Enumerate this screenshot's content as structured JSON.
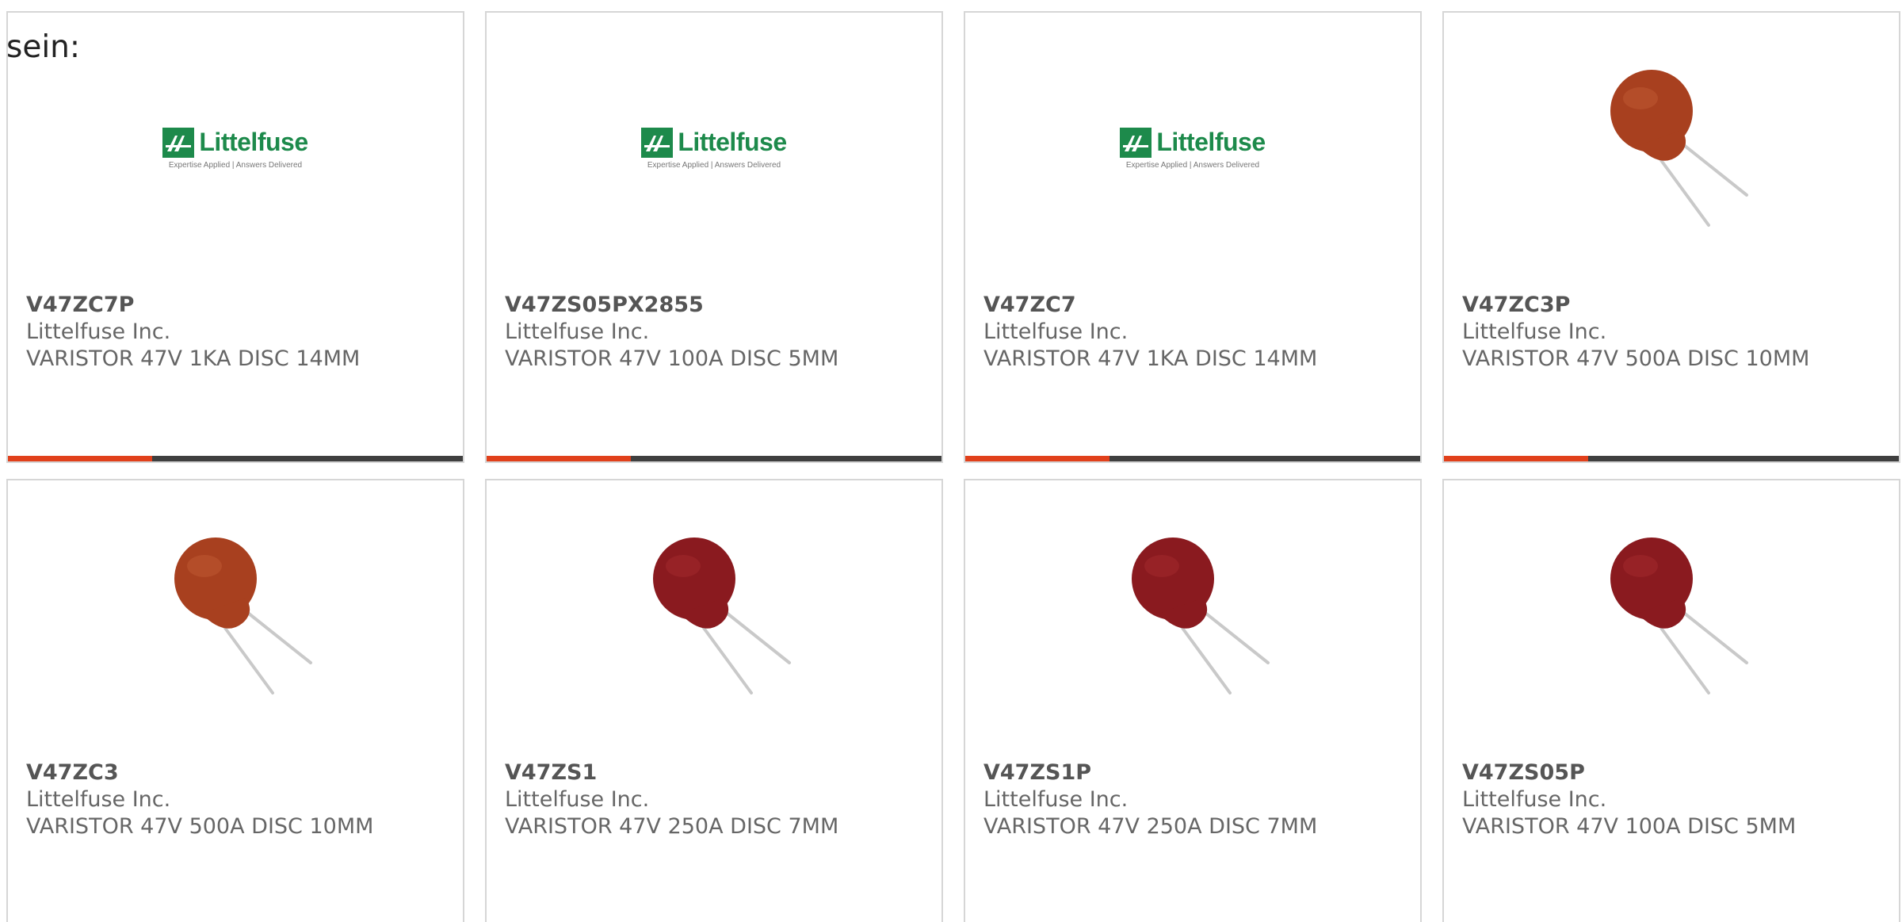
{
  "intro_text": "sein:",
  "brand_colors": {
    "accent": "#e1401b",
    "bar": "#3f3f3f",
    "logo_green": "#1d8a4b",
    "varistor_orange_brown": "#a8401f",
    "varistor_dark_red": "#8a1a1f"
  },
  "logo": {
    "wordmark": "Littelfuse",
    "tagline": "Expertise Applied | Answers Delivered"
  },
  "products": [
    {
      "part_number": "V47ZC7P",
      "manufacturer": "Littelfuse Inc.",
      "description": "VARISTOR 47V 1KA DISC 14MM",
      "image": "littelfuse-logo"
    },
    {
      "part_number": "V47ZS05PX2855",
      "manufacturer": "Littelfuse Inc.",
      "description": "VARISTOR 47V 100A DISC 5MM",
      "image": "littelfuse-logo"
    },
    {
      "part_number": "V47ZC7",
      "manufacturer": "Littelfuse Inc.",
      "description": "VARISTOR 47V 1KA DISC 14MM",
      "image": "littelfuse-logo"
    },
    {
      "part_number": "V47ZC3P",
      "manufacturer": "Littelfuse Inc.",
      "description": "VARISTOR 47V 500A DISC 10MM",
      "image": "varistor-orange-brown"
    },
    {
      "part_number": "V47ZC3",
      "manufacturer": "Littelfuse Inc.",
      "description": "VARISTOR 47V 500A DISC 10MM",
      "image": "varistor-orange-brown"
    },
    {
      "part_number": "V47ZS1",
      "manufacturer": "Littelfuse Inc.",
      "description": "VARISTOR 47V 250A DISC 7MM",
      "image": "varistor-dark-red"
    },
    {
      "part_number": "V47ZS1P",
      "manufacturer": "Littelfuse Inc.",
      "description": "VARISTOR 47V 250A DISC 7MM",
      "image": "varistor-dark-red"
    },
    {
      "part_number": "V47ZS05P",
      "manufacturer": "Littelfuse Inc.",
      "description": "VARISTOR 47V 100A DISC 5MM",
      "image": "varistor-dark-red"
    }
  ]
}
